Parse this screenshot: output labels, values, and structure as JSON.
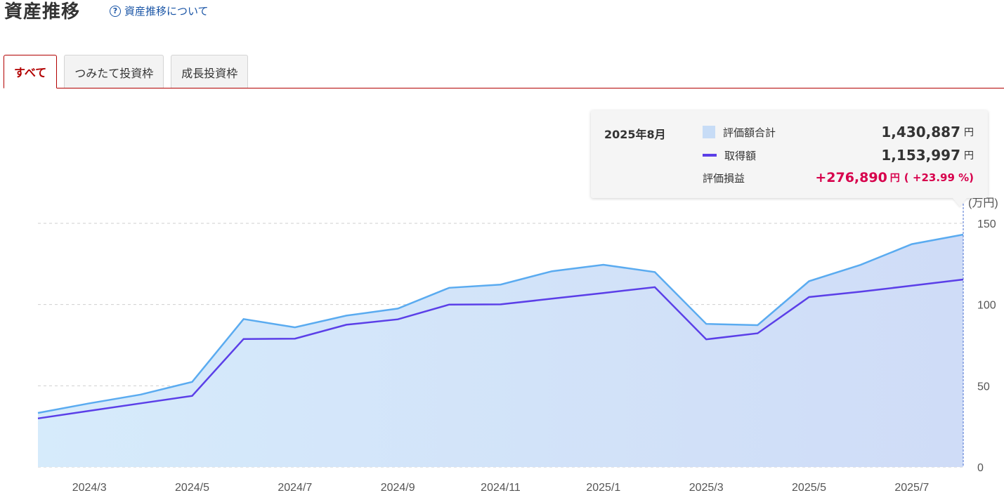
{
  "header": {
    "title": "資産推移",
    "about_link": "資産推移について",
    "help_icon_glyph": "?"
  },
  "tabs": [
    {
      "label": "すべて",
      "active": true
    },
    {
      "label": "つみたて投資枠",
      "active": false
    },
    {
      "label": "成長投資枠",
      "active": false
    }
  ],
  "colors": {
    "accent": "#b20000",
    "link": "#1a55a6",
    "valuation_line": "#5aabf0",
    "cost_line": "#5b3fe8",
    "gain": "#d7004c"
  },
  "chart_data": {
    "type": "area",
    "x": [
      "2024/2",
      "2024/3",
      "2024/4",
      "2024/5",
      "2024/6",
      "2024/7",
      "2024/8",
      "2024/9",
      "2024/10",
      "2024/11",
      "2024/12",
      "2025/1",
      "2025/2",
      "2025/3",
      "2025/4",
      "2025/5",
      "2025/6",
      "2025/7",
      "2025/8"
    ],
    "x_tick_labels": [
      "2024/3",
      "2024/5",
      "2024/7",
      "2024/9",
      "2024/11",
      "2025/1",
      "2025/3",
      "2025/5",
      "2025/7"
    ],
    "series": [
      {
        "key": "valuation",
        "values": [
          33.3,
          39.2,
          44.6,
          52.4,
          91.1,
          86.0,
          93.2,
          97.5,
          110.3,
          112.3,
          120.5,
          124.5,
          120.0,
          88.1,
          87.3,
          114.4,
          124.4,
          137.2,
          143.1
        ]
      },
      {
        "key": "cost",
        "values": [
          29.9,
          34.6,
          39.2,
          43.8,
          78.8,
          79.0,
          87.6,
          90.9,
          100.0,
          100.1,
          103.6,
          107.1,
          110.7,
          78.6,
          82.3,
          104.6,
          107.9,
          111.6,
          115.4
        ]
      }
    ],
    "ylim": [
      0,
      150
    ],
    "y_ticks": [
      0,
      50,
      100,
      150
    ],
    "y_unit": "(万円)",
    "grid": true
  },
  "tooltip": {
    "date": "2025年8月",
    "valuation_label": "評価額合計",
    "valuation_value": "1,430,887",
    "cost_label": "取得額",
    "cost_value": "1,153,997",
    "gain_label": "評価損益",
    "gain_value": "+276,890",
    "gain_pct": "( +23.99 %)",
    "unit": "円"
  }
}
